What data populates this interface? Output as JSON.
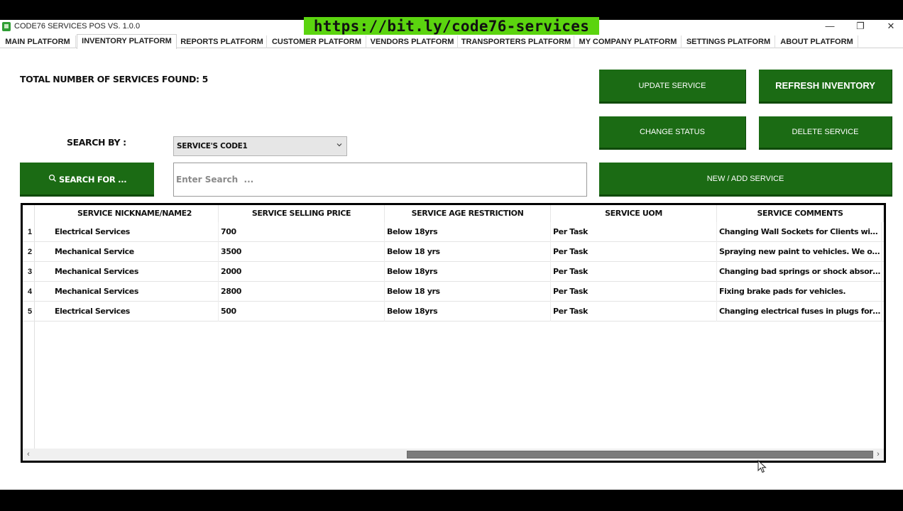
{
  "window": {
    "title": "CODE76 SERVICES POS VS. 1.0.0",
    "url_banner": "https://bit.ly/code76-services",
    "controls": {
      "minimize": "—",
      "restore": "❐",
      "close": "✕"
    }
  },
  "tabs": [
    {
      "label": "MAIN PLATFORM"
    },
    {
      "label": "INVENTORY PLATFORM",
      "active": true
    },
    {
      "label": "REPORTS PLATFORM"
    },
    {
      "label": "CUSTOMER PLATFORM"
    },
    {
      "label": "VENDORS PLATFORM"
    },
    {
      "label": "TRANSPORTERS PLATFORM"
    },
    {
      "label": "MY COMPANY PLATFORM"
    },
    {
      "label": "SETTINGS PLATFORM"
    },
    {
      "label": "ABOUT PLATFORM"
    }
  ],
  "summary": {
    "label": "TOTAL NUMBER OF SERVICES FOUND:",
    "count": "5"
  },
  "buttons": {
    "update_service": "UPDATE SERVICE",
    "refresh_inventory": "REFRESH INVENTORY",
    "change_status": "CHANGE STATUS",
    "delete_service": "DELETE SERVICE",
    "new_add_service": "NEW / ADD  SERVICE",
    "search_for": "SEARCH FOR ..."
  },
  "search": {
    "by_label": "SEARCH BY :",
    "selected_field": "SERVICE'S CODE1",
    "placeholder": "Enter Search  ...",
    "value": ""
  },
  "table": {
    "columns": [
      "SERVICE NICKNAME/NAME2",
      "SERVICE SELLING PRICE",
      "SERVICE AGE RESTRICTION",
      "SERVICE UOM",
      "SERVICE COMMENTS"
    ],
    "rows": [
      {
        "num": "1",
        "cells": [
          "Electrical Services",
          "700",
          "Below 18yrs",
          "Per Task",
          "Changing Wall Sockets for Clients with jus..."
        ]
      },
      {
        "num": "2",
        "cells": [
          "Mechanical Service",
          "3500",
          "Below 18 yrs",
          "Per Task",
          "Spraying new paint to vehicles. We only ..."
        ]
      },
      {
        "num": "3",
        "cells": [
          "Mechanical Services",
          "2000",
          "Below 18yrs",
          "Per Task",
          "Changing bad springs or shock absorbers f..."
        ]
      },
      {
        "num": "4",
        "cells": [
          "Mechanical Services",
          "2800",
          "Below 18 yrs",
          "Per Task",
          "Fixing brake pads for vehicles."
        ]
      },
      {
        "num": "5",
        "cells": [
          "Electrical Services",
          "500",
          "Below 18yrs",
          "Per Task",
          "Changing electrical fuses in plugs for Clie..."
        ]
      }
    ],
    "scroll": {
      "left_arrow": "‹",
      "right_arrow": "›"
    }
  },
  "colors": {
    "button_green": "#1b6b14",
    "banner_green": "#5bd40f",
    "grid_border": "#000000"
  }
}
